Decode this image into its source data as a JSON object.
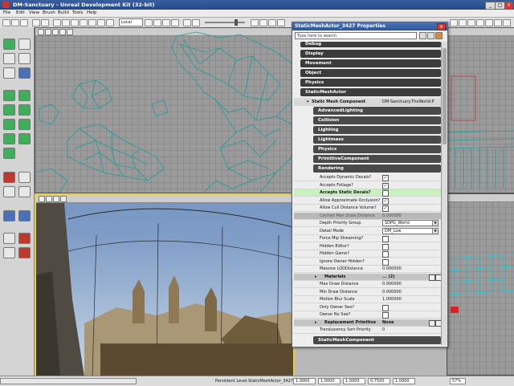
{
  "window": {
    "title": "DM-Sanctuary - Unreal Development Kit (32-bit)"
  },
  "menu": [
    "File",
    "Edit",
    "View",
    "Brush",
    "Build",
    "Tools",
    "Help"
  ],
  "toolbar": {
    "coord_mode": "Local"
  },
  "properties": {
    "title": "StaticMeshActor_3427 Properties",
    "search_placeholder": "Type here to search",
    "top_categories": [
      "Debug",
      "Display",
      "Movement",
      "Object",
      "Physics",
      "StaticMeshActor"
    ],
    "component": {
      "label": "Static Mesh Component",
      "value": "DM-Sanctuary.TheWorld:P"
    },
    "sub_categories": [
      "AdvancedLighting",
      "Collision",
      "Lighting",
      "Lightmass",
      "Physics",
      "PrimitiveComponent",
      "Rendering"
    ],
    "rows": [
      {
        "label": "Accepts Dynamic Decals?",
        "type": "check",
        "checked": true
      },
      {
        "label": "Accepts Foliage?",
        "type": "check",
        "checked": true
      },
      {
        "label": "Accepts Static Decals?",
        "type": "check",
        "checked": false,
        "highlight": true
      },
      {
        "label": "Allow Approximate Occlusion?",
        "type": "check",
        "checked": true
      },
      {
        "label": "Allow Cull Distance Volume?",
        "type": "check",
        "checked": true
      },
      {
        "label": "Cached Max Draw Distance",
        "type": "value",
        "value": "0.000000",
        "disabled": true
      },
      {
        "label": "Depth Priority Group",
        "type": "dropdown",
        "value": "SDPG_World"
      },
      {
        "label": "Detail Mode",
        "type": "dropdown",
        "value": "DM_Low"
      },
      {
        "label": "Force Mip Streaming?",
        "type": "check",
        "checked": false
      },
      {
        "label": "Hidden Editor?",
        "type": "check",
        "checked": false
      },
      {
        "label": "Hidden Game?",
        "type": "check",
        "checked": false
      },
      {
        "label": "Ignore Owner Hidden?",
        "type": "check",
        "checked": false
      },
      {
        "label": "Massive LODDistance",
        "type": "value",
        "value": "0.000000"
      }
    ],
    "materials": {
      "label": "Materials",
      "value": "... (2)"
    },
    "rows2": [
      {
        "label": "Max Draw Distance",
        "type": "value",
        "value": "0.000000"
      },
      {
        "label": "Min Draw Distance",
        "type": "value",
        "value": "0.000000"
      },
      {
        "label": "Motion Blur Scale",
        "type": "value",
        "value": "1.000000"
      },
      {
        "label": "Only Owner See?",
        "type": "check",
        "checked": false
      },
      {
        "label": "Owner No See?",
        "type": "check",
        "checked": false
      }
    ],
    "replacement": {
      "label": "Replacement Primitive",
      "value": "None"
    },
    "rows3": [
      {
        "label": "Translucency Sort Priority",
        "type": "value",
        "value": "0"
      }
    ],
    "bottom_category": "StaticMeshComponent"
  },
  "status": {
    "level": "Persistent Level.StaticMeshActor_3427",
    "fields": [
      "1.0000",
      "1.0000",
      "1.0000",
      "0.7500",
      "1.0000"
    ],
    "zoom": "57%"
  },
  "colors": {
    "title_bar": "#2c5596",
    "wireframe": "#1e9c9c",
    "category": "#3c3c3c",
    "highlight_row": "#c8f0c0"
  }
}
